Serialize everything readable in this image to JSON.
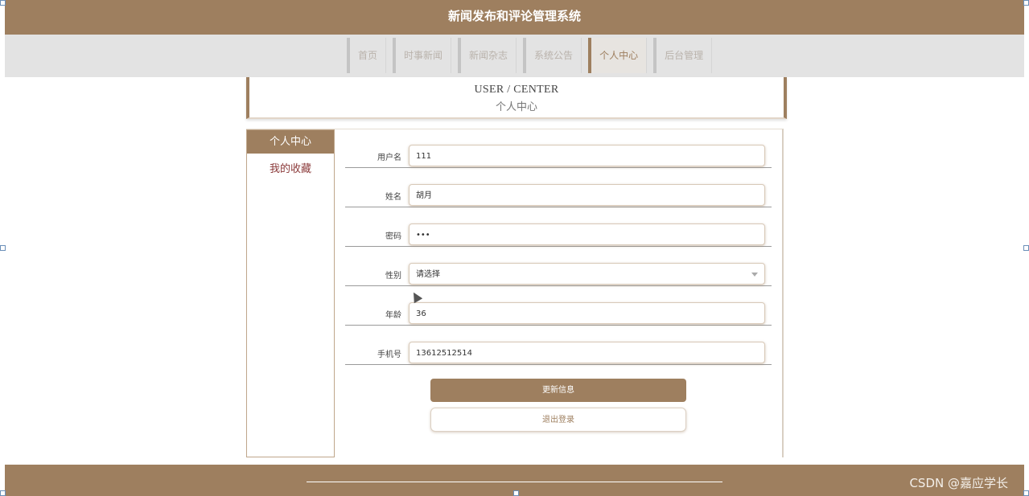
{
  "header": {
    "title": "新闻发布和评论管理系统"
  },
  "nav": {
    "items": [
      {
        "label": "首页"
      },
      {
        "label": "时事新闻"
      },
      {
        "label": "新闻杂志"
      },
      {
        "label": "系统公告"
      },
      {
        "label": "个人中心",
        "active": true
      },
      {
        "label": "后台管理"
      }
    ]
  },
  "page_title": {
    "en": "USER / CENTER",
    "zh": "个人中心"
  },
  "sidebar": {
    "active": "个人中心",
    "items": [
      {
        "label": "我的收藏"
      }
    ]
  },
  "form": {
    "fields": [
      {
        "label": "用户名",
        "value": "111"
      },
      {
        "label": "姓名",
        "value": "胡月"
      },
      {
        "label": "密码",
        "value": "•••"
      },
      {
        "label": "性别",
        "value": "请选择"
      },
      {
        "label": "年龄",
        "value": "36"
      },
      {
        "label": "手机号",
        "value": "13612512514"
      }
    ],
    "update_label": "更新信息",
    "logout_label": "退出登录"
  },
  "footer": {
    "watermark": "CSDN @嘉应学长"
  },
  "colors": {
    "brand": "#9e7f5f",
    "nav_bg": "#e3e3e3",
    "link": "#8b3a3a"
  }
}
